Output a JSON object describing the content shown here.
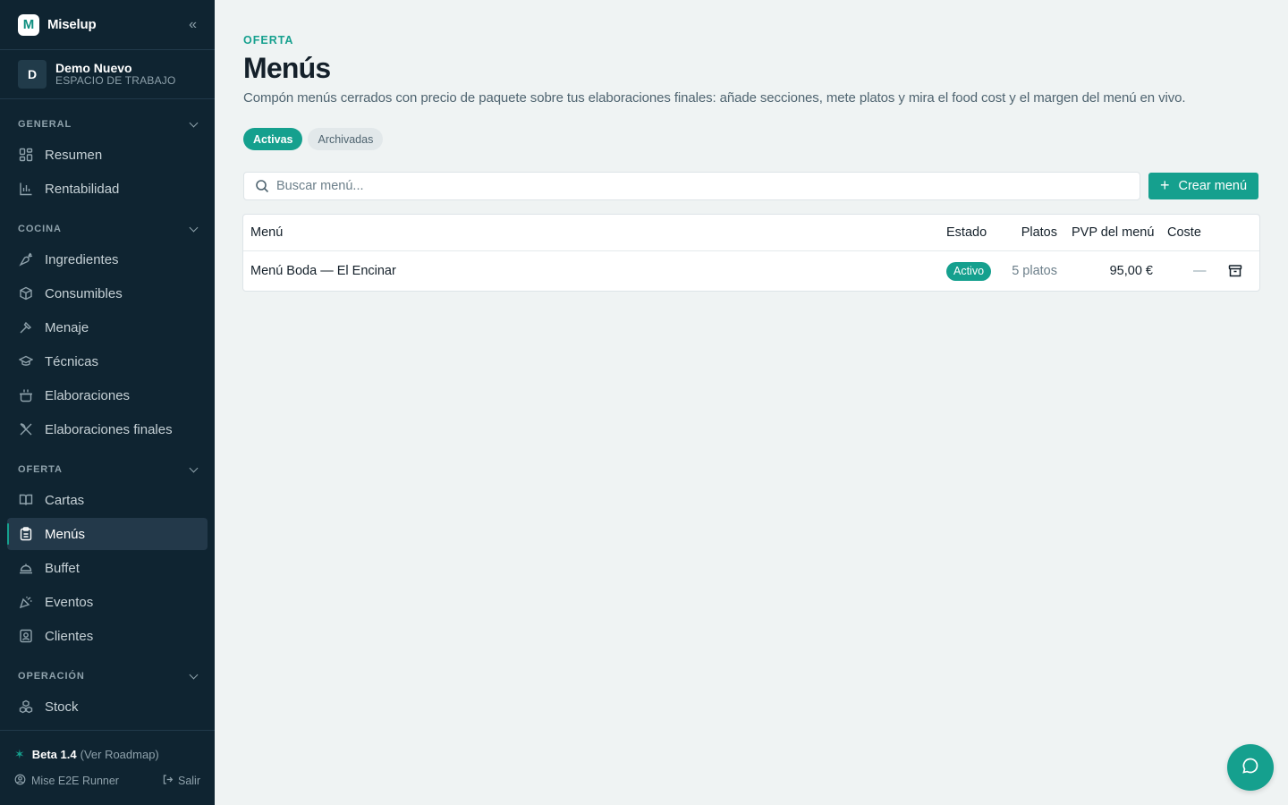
{
  "app": {
    "name": "Miselup",
    "logo_letter": "M",
    "collapse_icon": "«"
  },
  "workspace": {
    "initial": "D",
    "name": "Demo Nuevo",
    "subtitle": "ESPACIO DE TRABAJO"
  },
  "sidebar": {
    "sections": [
      {
        "label": "GENERAL",
        "items": [
          {
            "label": "Resumen",
            "icon": "grid-icon"
          },
          {
            "label": "Rentabilidad",
            "icon": "bar-chart-icon"
          }
        ]
      },
      {
        "label": "COCINA",
        "items": [
          {
            "label": "Ingredientes",
            "icon": "carrot-icon"
          },
          {
            "label": "Consumibles",
            "icon": "box-icon"
          },
          {
            "label": "Menaje",
            "icon": "utensil-icon"
          },
          {
            "label": "Técnicas",
            "icon": "graduation-cap-icon"
          },
          {
            "label": "Elaboraciones",
            "icon": "pot-icon"
          },
          {
            "label": "Elaboraciones finales",
            "icon": "fork-knife-icon"
          }
        ]
      },
      {
        "label": "OFERTA",
        "items": [
          {
            "label": "Cartas",
            "icon": "book-icon"
          },
          {
            "label": "Menús",
            "icon": "clipboard-icon",
            "active": true
          },
          {
            "label": "Buffet",
            "icon": "cloche-icon"
          },
          {
            "label": "Eventos",
            "icon": "party-icon"
          },
          {
            "label": "Clientes",
            "icon": "contact-icon"
          }
        ]
      },
      {
        "label": "OPERACIÓN",
        "items": [
          {
            "label": "Stock",
            "icon": "boxes-icon"
          }
        ]
      }
    ],
    "footer": {
      "beta": "Beta 1.4",
      "roadmap": "(Ver Roadmap)",
      "user": "Mise E2E Runner",
      "logout": "Salir"
    }
  },
  "page": {
    "eyebrow": "OFERTA",
    "title": "Menús",
    "description": "Compón menús cerrados con precio de paquete sobre tus elaboraciones finales: añade secciones, mete platos y mira el food cost y el margen del menú en vivo.",
    "tabs": [
      {
        "label": "Activas",
        "active": true
      },
      {
        "label": "Archivadas",
        "active": false
      }
    ],
    "search": {
      "placeholder": "Buscar menú...",
      "value": ""
    },
    "create_button": "Crear menú"
  },
  "table": {
    "columns": {
      "menu": "Menú",
      "estado": "Estado",
      "platos": "Platos",
      "pvp": "PVP del menú",
      "coste": "Coste"
    },
    "rows": [
      {
        "menu": "Menú Boda — El Encinar",
        "estado": "Activo",
        "platos": "5 platos",
        "pvp": "95,00 €",
        "coste": "—"
      }
    ]
  },
  "colors": {
    "accent": "#15a08e",
    "sidebar_bg": "#0f2431",
    "page_bg": "#eff3f3"
  }
}
